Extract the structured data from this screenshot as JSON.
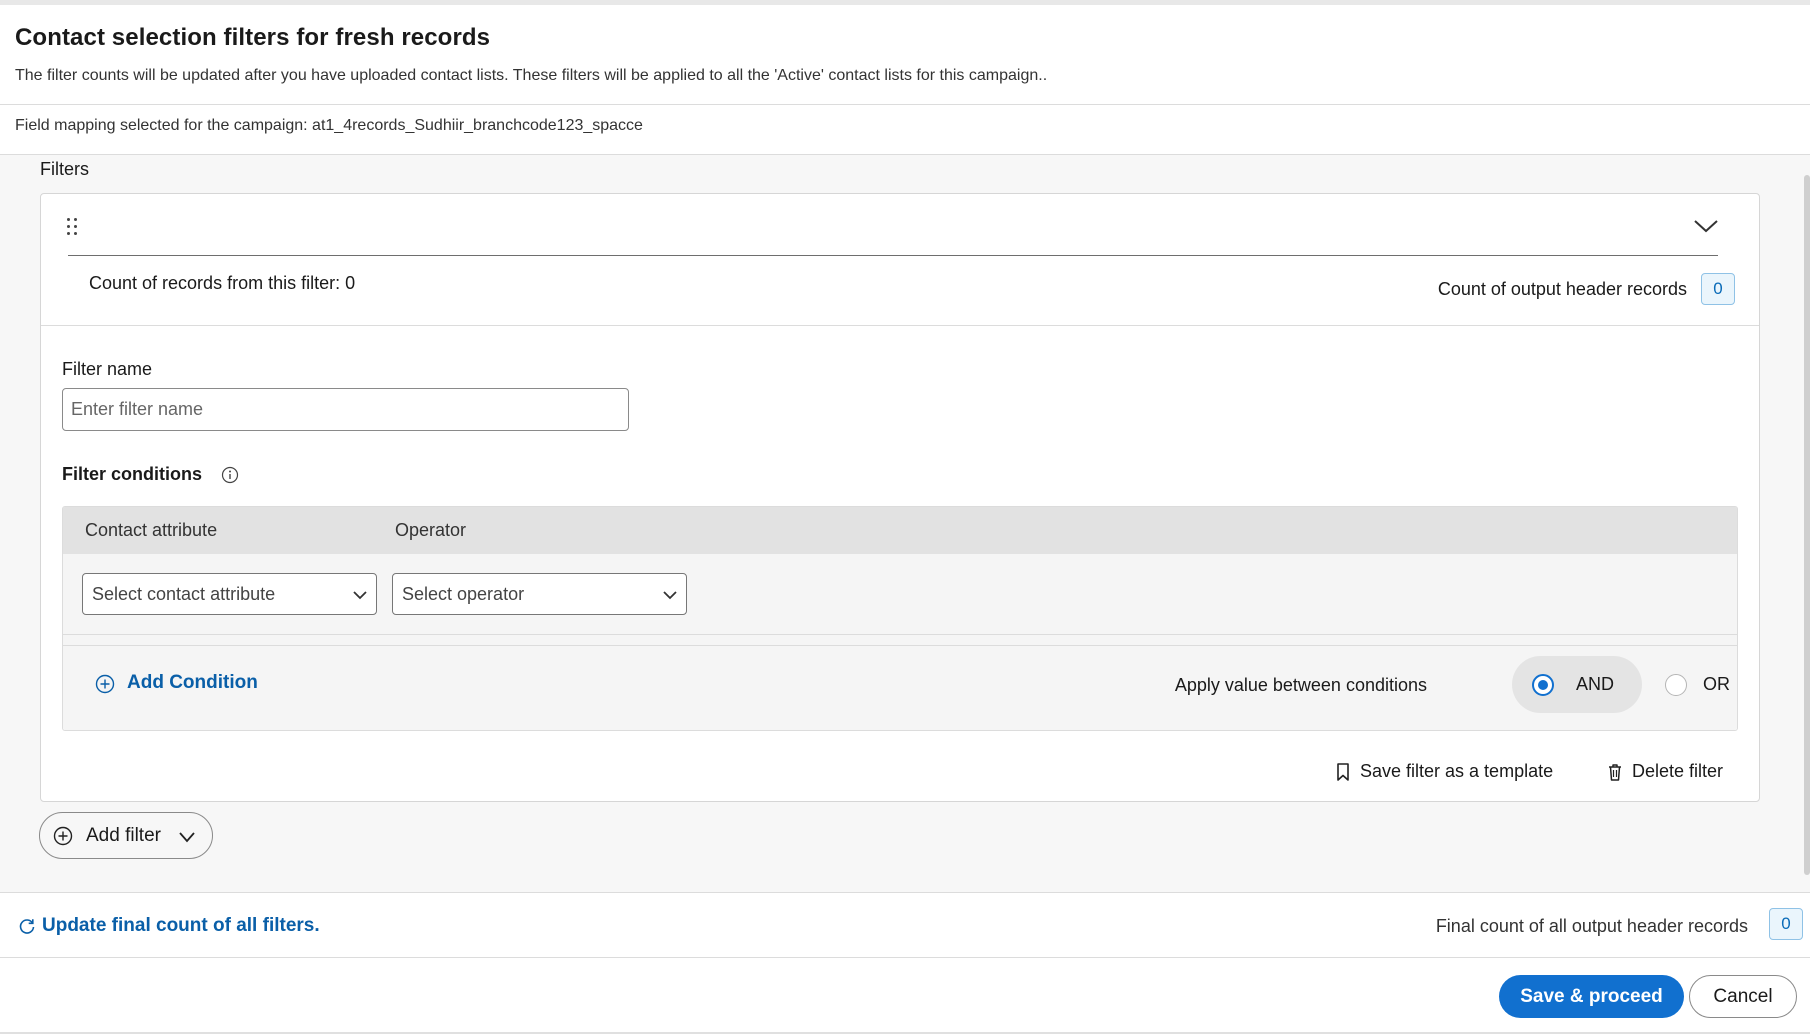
{
  "header": {
    "title": "Contact selection filters for fresh records",
    "subtitle": "The filter counts will be updated after you have uploaded contact lists. These filters will be applied to all the 'Active' contact lists for this campaign.."
  },
  "mapping": {
    "text": "Field mapping selected for the campaign: at1_4records_Sudhiir_branchcode123_spacce"
  },
  "filters_section": {
    "label": "Filters"
  },
  "filter_card": {
    "count_records_label": "Count of records from this filter: 0",
    "count_output_label": "Count of output header records",
    "count_output_value": "0",
    "filter_name_label": "Filter name",
    "filter_name_value": "",
    "filter_name_placeholder": "Enter filter name",
    "conditions_label": "Filter conditions",
    "columns": [
      "Contact attribute",
      "Operator"
    ],
    "contact_attribute_select": "Select contact attribute",
    "operator_select": "Select operator",
    "add_condition_label": "Add Condition",
    "apply_between_label": "Apply value between conditions",
    "logic_options": [
      "AND",
      "OR"
    ],
    "logic_selected": "AND",
    "save_template_label": "Save filter as a template",
    "delete_filter_label": "Delete filter"
  },
  "add_filter_label": "Add filter",
  "count_bar": {
    "update_label": "Update final count of all filters.",
    "final_count_label": "Final count of all output header records",
    "final_count_value": "0"
  },
  "footer": {
    "save_proceed_label": "Save & proceed",
    "cancel_label": "Cancel"
  },
  "colors": {
    "primary": "#1170cf",
    "link": "#0a5fa8",
    "badge_bg": "#eaf5fc",
    "badge_border": "#8fc2e6",
    "surface": "#f7f7f7"
  },
  "icons": [
    "drag-handle-icon",
    "chevron-down-icon",
    "info-icon",
    "add-circle-icon",
    "bookmark-icon",
    "trash-icon",
    "refresh-icon"
  ]
}
